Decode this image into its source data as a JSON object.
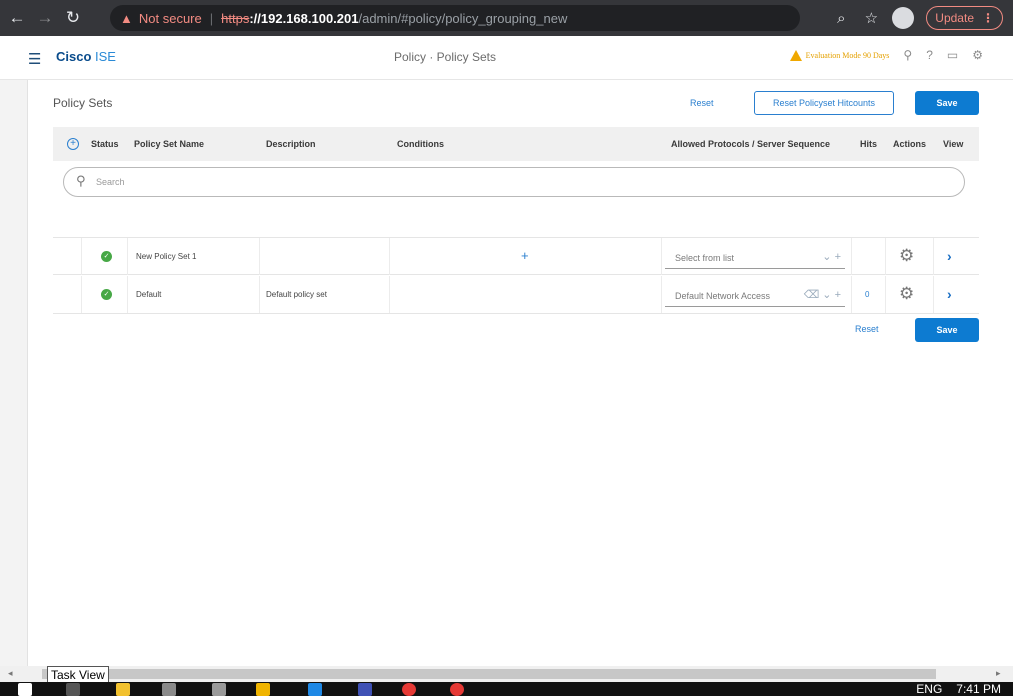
{
  "browser": {
    "not_secure": "Not secure",
    "url_scheme": "https",
    "url_host": "://192.168.100.201",
    "url_path": "/admin/#policy/policy_grouping_new",
    "update_label": "Update"
  },
  "header": {
    "brand_cisco": "Cisco",
    "brand_ise": " ISE",
    "title": "Policy · Policy Sets",
    "eval_mode": "Evaluation Mode 90 Days"
  },
  "page": {
    "title": "Policy Sets",
    "reset_label": "Reset",
    "reset_hitcounts_label": "Reset Policyset Hitcounts",
    "save_label": "Save",
    "bottom_reset_label": "Reset",
    "bottom_save_label": "Save"
  },
  "table": {
    "columns": [
      "Status",
      "Policy Set Name",
      "Description",
      "Conditions",
      "Allowed Protocols / Server Sequence",
      "Hits",
      "Actions",
      "View"
    ],
    "search_placeholder": "Search",
    "rows": [
      {
        "name": "New Policy Set 1",
        "description": "",
        "protocol": "Select from list",
        "hits": ""
      },
      {
        "name": "Default",
        "description": "Default policy set",
        "protocol": "Default Network Access",
        "hits": "0"
      }
    ]
  },
  "taskbar": {
    "tooltip": "Task View",
    "lang": "ENG",
    "time": "7:41 PM"
  },
  "colors": {
    "accent": "#0d7bd1",
    "status_ok": "#47a846",
    "warning": "#f0a800"
  }
}
